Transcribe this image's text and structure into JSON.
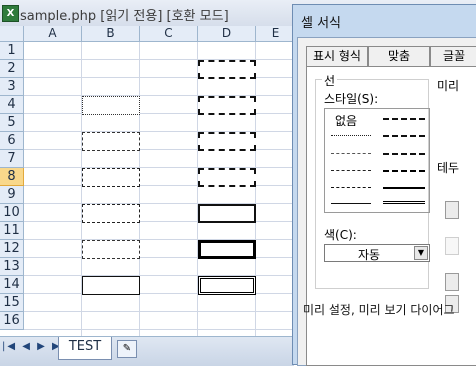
{
  "window": {
    "app_icon_glyph": "X",
    "title": "sample.php  [읽기 전용]  [호환 모드]"
  },
  "sheet": {
    "columns": [
      "A",
      "B",
      "C",
      "D",
      "E"
    ],
    "rows": [
      "1",
      "2",
      "3",
      "4",
      "5",
      "6",
      "7",
      "8",
      "9",
      "10",
      "11",
      "12",
      "13",
      "14",
      "15",
      "16"
    ],
    "selected_row": "8"
  },
  "sheet_tabs": {
    "nav_glyphs": "◀◀◀▶▶▶",
    "nav_first": "|◀",
    "nav_prev": "◀",
    "nav_next": "▶",
    "nav_last": "▶|",
    "active_tab": "TEST",
    "new_tab_glyph": "✎"
  },
  "dialog": {
    "title": "셀 서식",
    "tabs": [
      "표시 형식",
      "맞춤",
      "글꼴"
    ],
    "line_group_title": "선",
    "style_label": "스타일(S):",
    "none_label": "없음",
    "color_label": "색(C):",
    "color_value": "자동",
    "presets_label": "미리",
    "border_label": "테두",
    "help_text": "미리 설정, 미리 보기 다이어그"
  }
}
